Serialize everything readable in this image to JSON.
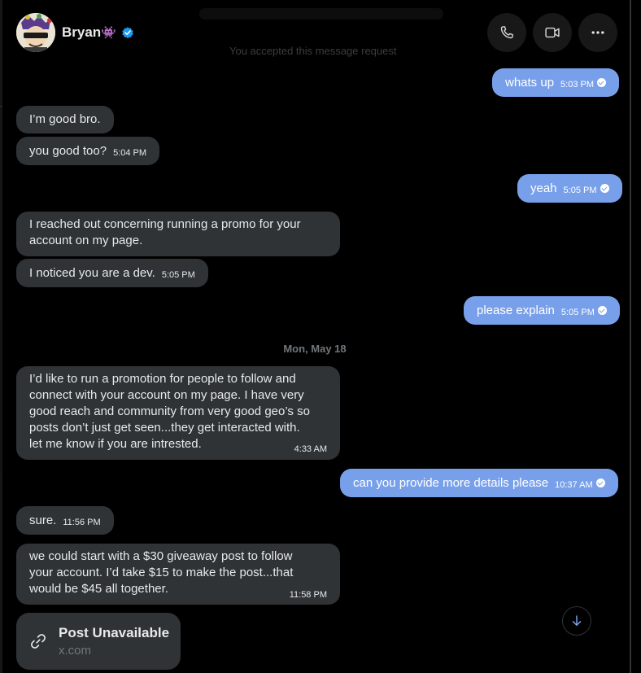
{
  "header": {
    "name": "Bryan",
    "emoji": "👾",
    "notice": "You accepted this message request"
  },
  "icons": {
    "call": "phone-icon",
    "video": "video-icon",
    "more": "more-icon",
    "verified": "verified-badge-icon",
    "link": "link-icon",
    "scroll": "arrow-down-icon"
  },
  "colors": {
    "outgoing_bubble": "#78a0ea",
    "incoming_bubble": "#2f3336",
    "verified": "#1d9bf0"
  },
  "messages": [
    {
      "dir": "out",
      "text": "whats up",
      "time": "5:03 PM",
      "read": true
    },
    {
      "dir": "in",
      "text": "I’m good bro.",
      "time": ""
    },
    {
      "dir": "in",
      "text": "you good too?",
      "time": "5:04 PM"
    },
    {
      "dir": "out",
      "text": "yeah",
      "time": "5:05 PM",
      "read": true
    },
    {
      "dir": "in",
      "lines": [
        "I reached out concerning running a promo for your",
        "account on my page."
      ],
      "time": ""
    },
    {
      "dir": "in",
      "text": "I noticed you are a dev.",
      "time": "5:05 PM"
    },
    {
      "dir": "out",
      "text": "please explain",
      "time": "5:05 PM",
      "read": true
    },
    {
      "dir": "in",
      "lines": [
        "I’d like to run a promotion for people to follow and",
        "connect with your account on my page. I have very",
        "good reach and community from very good geo’s so",
        "posts don’t just get seen...they get interacted with.",
        "let me know if you are intrested."
      ],
      "time": "4:33 AM"
    },
    {
      "dir": "out",
      "text": "can you provide more details please",
      "time": "10:37 AM",
      "read": true
    },
    {
      "dir": "in",
      "text": "sure.",
      "time": "11:56 PM"
    },
    {
      "dir": "in",
      "lines": [
        "we could start with a $30 giveaway post to follow",
        "your account. I’d take $15 to make the post...that",
        "would be $45 all together."
      ],
      "time": "11:58 PM"
    }
  ],
  "date_separator": "Mon, May 18",
  "link_card": {
    "title": "Post Unavailable",
    "domain": "x.com"
  }
}
